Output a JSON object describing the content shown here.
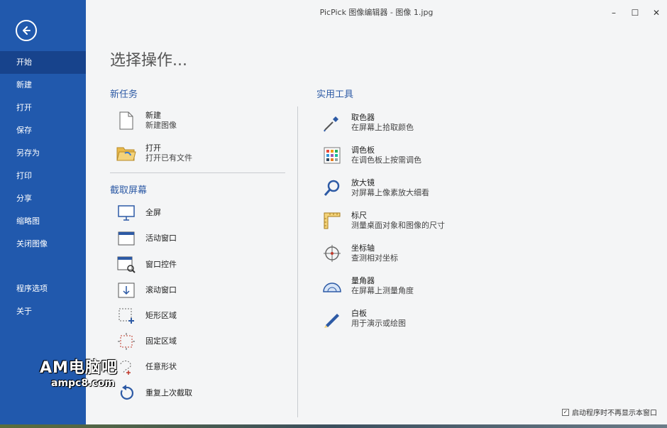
{
  "window": {
    "title": "PicPick 图像编辑器 - 图像 1.jpg",
    "controls": {
      "minimize": "–",
      "maximize": "☐",
      "close": "✕"
    }
  },
  "sidebar": {
    "items": [
      {
        "label": "开始",
        "active": true
      },
      {
        "label": "新建"
      },
      {
        "label": "打开"
      },
      {
        "label": "保存"
      },
      {
        "label": "另存为"
      },
      {
        "label": "打印"
      },
      {
        "label": "分享"
      },
      {
        "label": "缩略图"
      },
      {
        "label": "关闭图像"
      }
    ],
    "bottom_items": [
      {
        "label": "程序选项"
      },
      {
        "label": "关于"
      }
    ]
  },
  "main": {
    "title": "选择操作...",
    "new_task": {
      "title": "新任务",
      "items": [
        {
          "label": "新建",
          "desc": "新建图像",
          "icon": "file-icon"
        },
        {
          "label": "打开",
          "desc": "打开已有文件",
          "icon": "folder-icon"
        }
      ]
    },
    "capture": {
      "title": "截取屏幕",
      "items": [
        {
          "label": "全屏",
          "icon": "monitor-icon"
        },
        {
          "label": "活动窗口",
          "icon": "window-icon"
        },
        {
          "label": "窗口控件",
          "icon": "window-control-icon"
        },
        {
          "label": "滚动窗口",
          "icon": "scroll-window-icon"
        },
        {
          "label": "矩形区域",
          "icon": "rect-region-icon"
        },
        {
          "label": "固定区域",
          "icon": "fixed-region-icon"
        },
        {
          "label": "任意形状",
          "icon": "freehand-icon"
        },
        {
          "label": "重复上次截取",
          "icon": "repeat-icon"
        }
      ]
    },
    "tools": {
      "title": "实用工具",
      "items": [
        {
          "label": "取色器",
          "desc": "在屏幕上拾取颜色",
          "icon": "eyedropper-icon"
        },
        {
          "label": "调色板",
          "desc": "在调色板上按需调色",
          "icon": "palette-icon"
        },
        {
          "label": "放大镜",
          "desc": "对屏幕上像素放大细看",
          "icon": "magnifier-icon"
        },
        {
          "label": "标尺",
          "desc": "测量桌面对象和图像的尺寸",
          "icon": "ruler-icon"
        },
        {
          "label": "坐标轴",
          "desc": "查测相对坐标",
          "icon": "crosshair-icon"
        },
        {
          "label": "量角器",
          "desc": "在屏幕上测量角度",
          "icon": "protractor-icon"
        },
        {
          "label": "白板",
          "desc": "用于演示或绘图",
          "icon": "pen-icon"
        }
      ]
    },
    "footer": {
      "checkbox_label": "启动程序时不再显示本窗口",
      "checked": true
    }
  },
  "watermark": {
    "line1": "AM电脑吧",
    "line2": "ampc8.com"
  },
  "colors": {
    "sidebar": "#2159ad",
    "sidebar_active": "#17438c",
    "accent": "#2d5aa5"
  }
}
